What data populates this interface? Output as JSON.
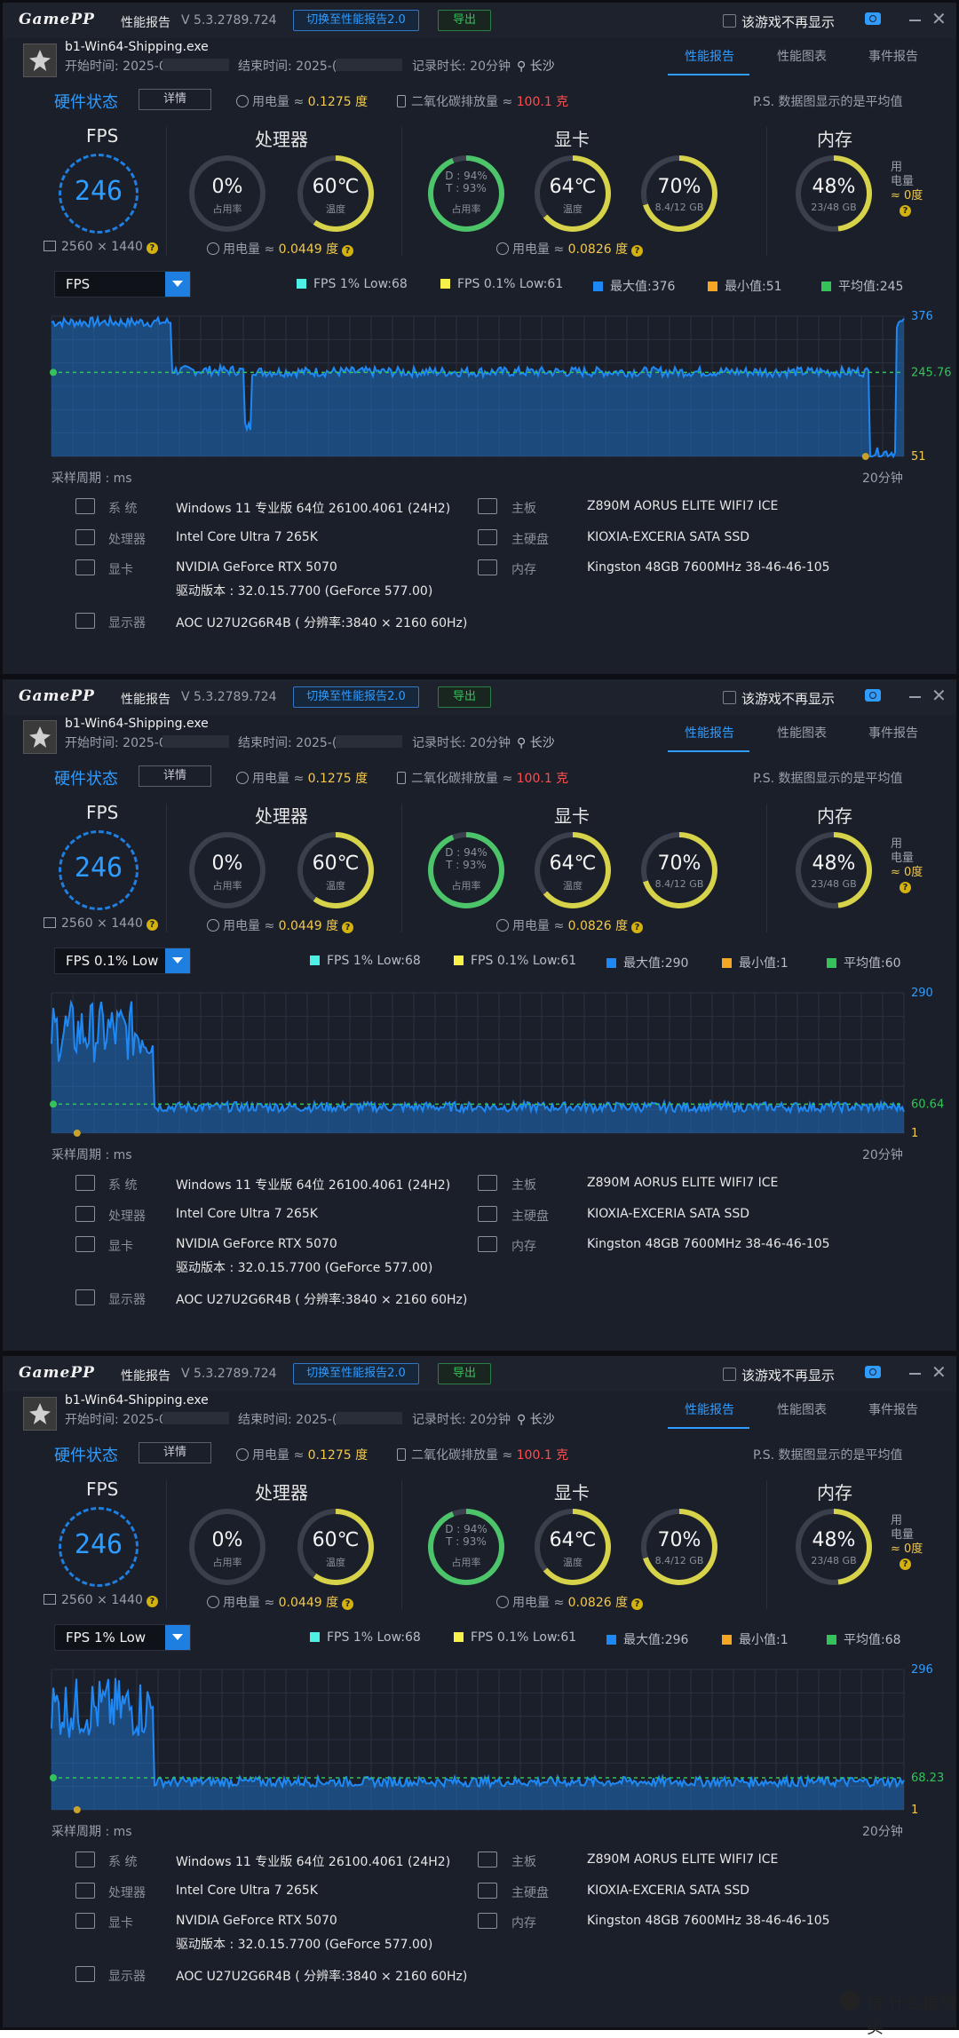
{
  "app": {
    "logo": "GamePP",
    "title": "性能报告",
    "version": "V 5.3.2789.724",
    "switch_label": "切换至性能报告2.0",
    "export_label": "导出",
    "dont_show_label": "该游戏不再显示"
  },
  "process": {
    "name": "b1-Win64-Shipping.exe",
    "start_label": "开始时间: 2025-0",
    "end_label": "结束时间: 2025-(",
    "duration_label": "记录时长: 20分钟",
    "location": "长沙"
  },
  "tabs": [
    "性能报告",
    "性能图表",
    "事件报告"
  ],
  "hardware": {
    "title": "硬件状态",
    "detail_label": "详情",
    "power_label": "用电量 ≈ ",
    "power_value": "0.1275 度",
    "co2_label": "二氧化碳排放量 ≈ ",
    "co2_value": "100.1 克",
    "note": "P.S. 数据图显示的是平均值"
  },
  "sections": {
    "fps": "FPS",
    "cpu": "处理器",
    "gpu": "显卡",
    "mem": "内存"
  },
  "gauges": {
    "fps_value": "246",
    "resolution": "2560 × 1440",
    "cpu_usage": "0%",
    "cpu_usage_label": "占用率",
    "cpu_temp": "60℃",
    "cpu_temp_label": "温度",
    "cpu_power_label": "用电量 ≈ ",
    "cpu_power_value": "0.0449 度",
    "gpu_d": "D : 94%",
    "gpu_t": "T : 93%",
    "gpu_usage_label": "占用率",
    "gpu_temp": "64℃",
    "gpu_temp_label": "温度",
    "gpu_mem": "70%",
    "gpu_mem_sub": "8.4/12 GB",
    "gpu_power_label": "用电量 ≈ ",
    "gpu_power_value": "0.0826 度",
    "mem": "48%",
    "mem_sub": "23/48 GB",
    "mem_side_1": "用",
    "mem_side_2": "电量",
    "mem_side_3": "≈ 0度"
  },
  "colors": {
    "accent": "#2f9cff",
    "green": "#35c25a",
    "yellow": "#f2c94c",
    "red": "#ff4d4d",
    "cyan": "#4ef0e6",
    "orange": "#f5a623"
  },
  "legend_labels": {
    "p1": "FPS 1% Low:",
    "p01": "FPS 0.1% Low:",
    "max": "最大值:",
    "min": "最小值:",
    "avg": "平均值:"
  },
  "axis": {
    "left": "采样周期 : ms",
    "right": "20分钟"
  },
  "system": {
    "os_key": "系    统",
    "os": "Windows 11 专业版 64位 26100.4061 (24H2)",
    "cpu_key": "处理器",
    "cpu": "Intel Core Ultra 7 265K",
    "gpu_key": "显卡",
    "gpu": "NVIDIA GeForce RTX 5070",
    "driver": "驱动版本 : 32.0.15.7700 (GeForce 577.00)",
    "monitor_key": "显示器",
    "monitor": "AOC U27U2G6R4B ( 分辨率:3840 × 2160 60Hz)",
    "board_key": "主板",
    "board": "Z890M AORUS ELITE WIFI7 ICE",
    "disk_key": "主硬盘",
    "disk": "KIOXIA-EXCERIA SATA SSD",
    "ram_key": "内存",
    "ram": "Kingston 48GB 7600MHz 38-46-46-105"
  },
  "panels": [
    {
      "selector": "FPS",
      "low1": "68",
      "low01": "61",
      "max": "376",
      "min": "51",
      "avg": "245",
      "label_max": "376",
      "label_avg": "245.76",
      "label_min": "51"
    },
    {
      "selector": "FPS 0.1% Low",
      "low1": "68",
      "low01": "61",
      "max": "290",
      "min": "1",
      "avg": "60",
      "label_max": "290",
      "label_avg": "60.64",
      "label_min": "1"
    },
    {
      "selector": "FPS 1% Low",
      "low1": "68",
      "low01": "61",
      "max": "296",
      "min": "1",
      "avg": "68",
      "label_max": "296",
      "label_avg": "68.23",
      "label_min": "1"
    }
  ],
  "chart_data": [
    {
      "type": "area",
      "title": "FPS",
      "ylim": [
        51,
        376
      ],
      "avg": 245.76,
      "segments": [
        [
          0,
          0.14,
          362
        ],
        [
          0.14,
          0.19,
          250
        ],
        [
          0.19,
          0.225,
          250
        ],
        [
          0.225,
          0.235,
          120
        ],
        [
          0.235,
          0.24,
          250
        ],
        [
          0.24,
          0.96,
          247
        ],
        [
          0.96,
          0.99,
          60
        ],
        [
          0.99,
          1.0,
          360
        ]
      ]
    },
    {
      "type": "area",
      "title": "FPS 0.1% Low",
      "ylim": [
        1,
        290
      ],
      "avg": 60.64,
      "segments": [
        [
          0,
          0.12,
          210
        ],
        [
          0.12,
          1.0,
          55
        ]
      ]
    },
    {
      "type": "area",
      "title": "FPS 1% Low",
      "ylim": [
        1,
        296
      ],
      "avg": 68.23,
      "segments": [
        [
          0,
          0.12,
          215
        ],
        [
          0.12,
          1.0,
          60
        ]
      ]
    }
  ],
  "watermark": "值 什么值得买"
}
